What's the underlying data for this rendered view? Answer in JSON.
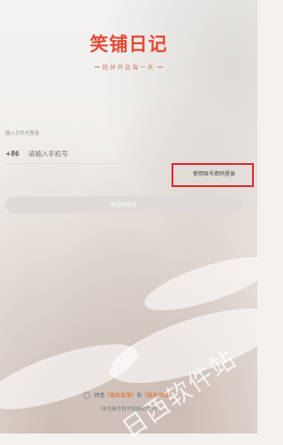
{
  "brand": {
    "title": "笑铺日记",
    "slogan": "陪伴开店每一天"
  },
  "login": {
    "phone_caption": "输入手机号登录",
    "country_code": "+86",
    "phone_placeholder": "请输入手机号",
    "alt_login_label": "使用账号密码登录",
    "get_code_label": "验证码直达"
  },
  "agreement": {
    "prefix": "同意",
    "privacy_link": "《隐私政策》",
    "and": "和",
    "service_link": "《服务协议》",
    "bottom_text": "（未注册手机号将自动注册）"
  },
  "watermark": {
    "text": "日西软件站"
  },
  "colors": {
    "brand": "#e34a34",
    "link": "#e0662b",
    "highlight": "#e02626",
    "button_disabled": "#dddad7"
  }
}
